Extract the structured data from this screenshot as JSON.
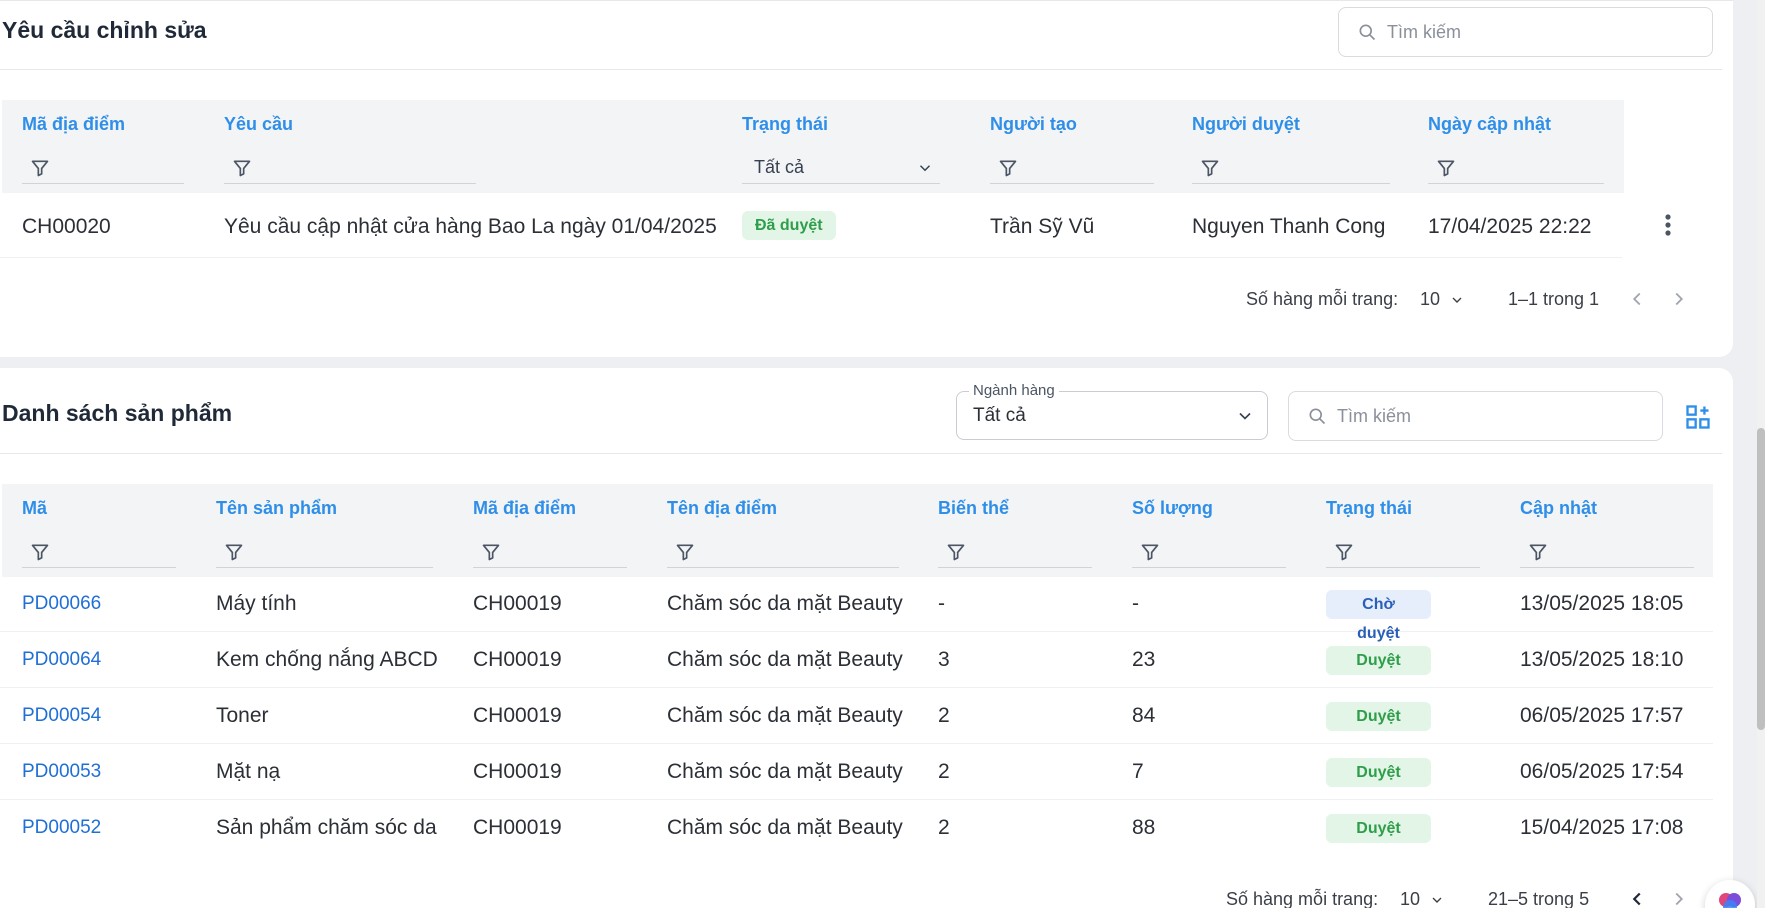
{
  "edit_requests": {
    "title": "Yêu cầu chỉnh sửa",
    "search_placeholder": "Tìm kiếm",
    "columns": [
      "Mã địa điểm",
      "Yêu cầu",
      "Trạng thái",
      "Người tạo",
      "Người duyệt",
      "Ngày cập nhật"
    ],
    "status_filter_value": "Tất cả",
    "rows": [
      {
        "location_code": "CH00020",
        "request": "Yêu cầu cập nhật cửa hàng Bao La ngày 01/04/2025",
        "status": "Đã duyệt",
        "creator": "Trần Sỹ Vũ",
        "approver": "Nguyen Thanh Cong",
        "updated": "17/04/2025 22:22"
      }
    ],
    "pager": {
      "rows_label": "Số hàng mỗi trang:",
      "rows_value": "10",
      "range": "1–1 trong 1"
    }
  },
  "products": {
    "title": "Danh sách sản phẩm",
    "category_label": "Ngành hàng",
    "category_value": "Tất cả",
    "search_placeholder": "Tìm kiếm",
    "columns": [
      "Mã",
      "Tên sản phẩm",
      "Mã địa điểm",
      "Tên địa điểm",
      "Biến thể",
      "Số lượng",
      "Trạng thái",
      "Cập nhật"
    ],
    "rows": [
      {
        "code": "PD00066",
        "name": "Máy tính",
        "location_code": "CH00019",
        "location_name": "Chăm sóc da mặt Beauty",
        "variants": "-",
        "quantity": "-",
        "status": "Chờ duyệt",
        "updated": "13/05/2025 18:05"
      },
      {
        "code": "PD00064",
        "name": "Kem chống nắng ABCD",
        "location_code": "CH00019",
        "location_name": "Chăm sóc da mặt Beauty",
        "variants": "3",
        "quantity": "23",
        "status": "Duyệt",
        "updated": "13/05/2025 18:10"
      },
      {
        "code": "PD00054",
        "name": "Toner",
        "location_code": "CH00019",
        "location_name": "Chăm sóc da mặt Beauty",
        "variants": "2",
        "quantity": "84",
        "status": "Duyệt",
        "updated": "06/05/2025 17:57"
      },
      {
        "code": "PD00053",
        "name": "Mặt nạ",
        "location_code": "CH00019",
        "location_name": "Chăm sóc da mặt Beauty",
        "variants": "2",
        "quantity": "7",
        "status": "Duyệt",
        "updated": "06/05/2025 17:54"
      },
      {
        "code": "PD00052",
        "name": "Sản phẩm chăm sóc da",
        "location_code": "CH00019",
        "location_name": "Chăm sóc da mặt Beauty",
        "variants": "2",
        "quantity": "88",
        "status": "Duyệt",
        "updated": "15/04/2025 17:08"
      }
    ],
    "pager": {
      "rows_label": "Số hàng mỗi trang:",
      "rows_value": "10",
      "range": "21–5 trong 5"
    }
  },
  "icons": {
    "search": "search-icon",
    "filter": "filter-icon",
    "chevron": "chevron-down-icon",
    "more": "more-vertical-icon",
    "grid": "grid-add-icon",
    "assistant": "brain-icon"
  },
  "colors": {
    "accent": "#2f8fe8",
    "link": "#1f6fd6",
    "approved_bg": "#e3f5e7",
    "approved_text": "#2e9e4b",
    "pending_bg": "#e6eefb",
    "pending_text": "#2a5fb8"
  }
}
